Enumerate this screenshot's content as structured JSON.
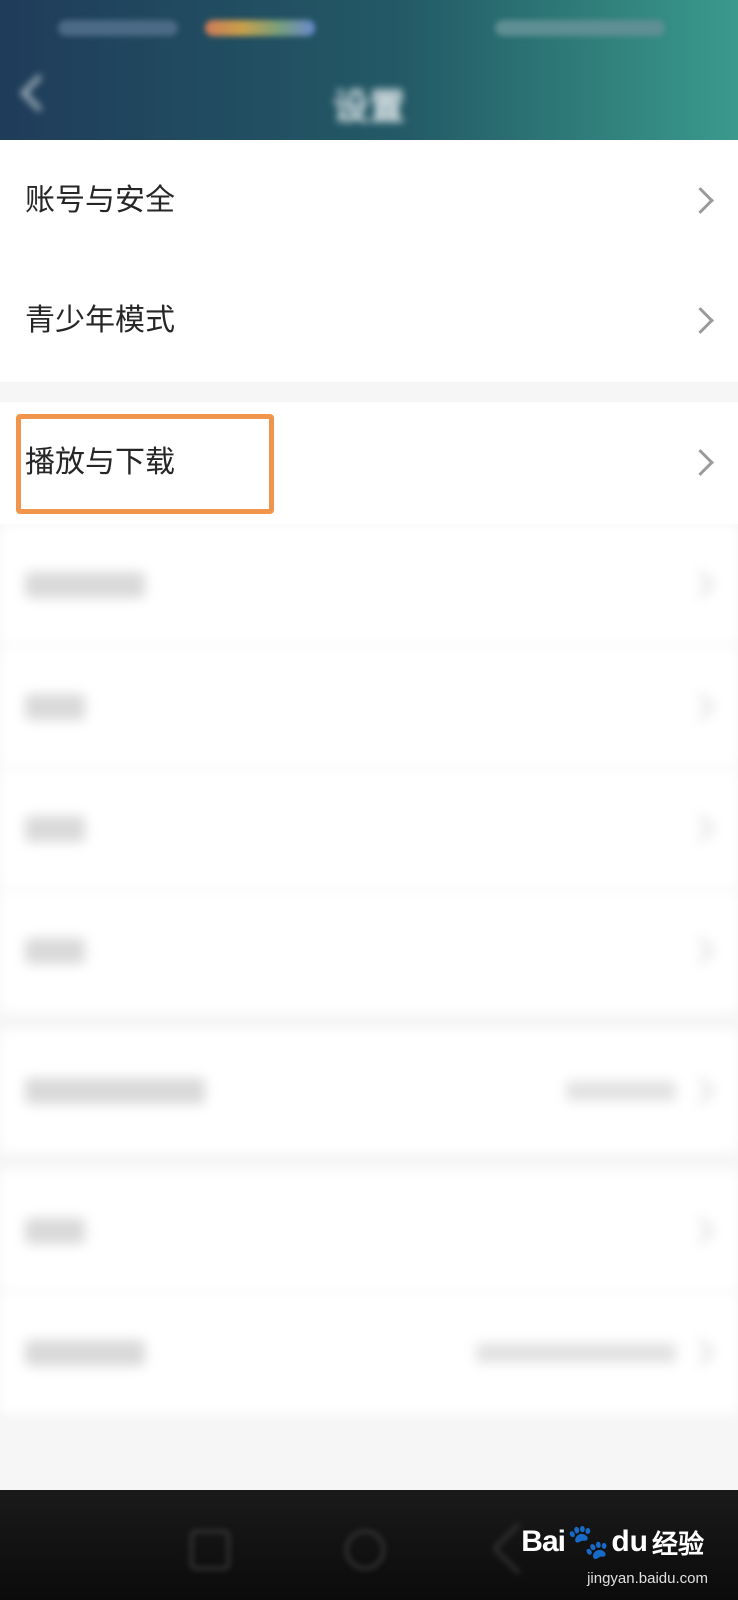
{
  "header": {
    "title": "设置",
    "back_icon": "chevron-left-icon",
    "colors": {
      "gradient_start": "#1f3c5a",
      "gradient_end": "#3a9a8c"
    }
  },
  "settings": {
    "group1": [
      {
        "label": "账号与安全",
        "icon": "chevron-right-icon"
      },
      {
        "label": "青少年模式",
        "icon": "chevron-right-icon"
      }
    ],
    "highlighted_item": {
      "label": "播放与下载",
      "icon": "chevron-right-icon"
    },
    "highlight_color": "#f0954b"
  },
  "watermark": {
    "brand_bai": "Bai",
    "brand_du": "du",
    "brand_suffix": "经验",
    "url": "jingyan.baidu.com"
  }
}
